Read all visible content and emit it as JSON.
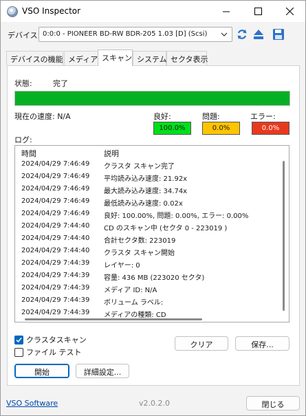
{
  "window": {
    "title": "VSO Inspector"
  },
  "device": {
    "label": "デバイス:",
    "selected": "0:0:0 - PIONEER BD-RW   BDR-205 1.03 [D] (Scsi)"
  },
  "tabs": [
    {
      "label": "デバイスの機能"
    },
    {
      "label": "メディア"
    },
    {
      "label": "スキャン"
    },
    {
      "label": "システム"
    },
    {
      "label": "セクタ表示"
    }
  ],
  "active_tab": "スキャン",
  "scan": {
    "status_label": "状態:",
    "status_value": "完了",
    "progress": 1.0,
    "progress_color": "#06b025",
    "speed_label": "現在の速度: N/A",
    "stats": [
      {
        "label": "良好:",
        "value": "100.0%",
        "color": "#00e01a"
      },
      {
        "label": "問題:",
        "value": "0.0%",
        "color": "#ffc400"
      },
      {
        "label": "エラー:",
        "value": "0.0%",
        "color": "#e8391d"
      }
    ]
  },
  "log": {
    "label": "ログ:",
    "columns": [
      "時間",
      "説明"
    ],
    "rows": [
      {
        "time": "2024/04/29 7:46:49",
        "desc": "クラスタ スキャン完了"
      },
      {
        "time": "2024/04/29 7:46:49",
        "desc": "平均読み込み速度: 21.92x"
      },
      {
        "time": "2024/04/29 7:46:49",
        "desc": "最大読み込み速度: 34.74x"
      },
      {
        "time": "2024/04/29 7:46:49",
        "desc": "最低読み込み速度: 0.02x"
      },
      {
        "time": "2024/04/29 7:46:49",
        "desc": "良好: 100.00%, 問題: 0.00%, エラー: 0.00%"
      },
      {
        "time": "2024/04/29 7:44:40",
        "desc": "CD のスキャン中 (セクタ 0 - 223019 )"
      },
      {
        "time": "2024/04/29 7:44:40",
        "desc": "合計セクタ数: 223019"
      },
      {
        "time": "2024/04/29 7:44:40",
        "desc": "クラスタ スキャン開始"
      },
      {
        "time": "2024/04/29 7:44:39",
        "desc": "レイヤー: 0"
      },
      {
        "time": "2024/04/29 7:44:39",
        "desc": "容量: 436 MB (223020 セクタ)"
      },
      {
        "time": "2024/04/29 7:44:39",
        "desc": "メディア ID: N/A"
      },
      {
        "time": "2024/04/29 7:44:39",
        "desc": "ボリューム ラベル:"
      },
      {
        "time": "2024/04/29 7:44:39",
        "desc": "メディアの種類: CD"
      }
    ]
  },
  "options": {
    "cluster_scan": {
      "label": "クラスタスキャン",
      "checked": true
    },
    "file_test": {
      "label": "ファイル テスト",
      "checked": false
    }
  },
  "buttons": {
    "clear": "クリア",
    "save": "保存...",
    "start": "開始",
    "advanced": "詳細設定...",
    "close": "閉じる"
  },
  "footer": {
    "link": "VSO Software",
    "version": "v2.0.2.0"
  },
  "icons": {
    "app": "disc-icon",
    "refresh": "refresh-icon",
    "eject": "eject-icon",
    "save": "floppy-save-icon"
  },
  "colors": {
    "accent": "#0067c0",
    "link": "#0047ab"
  }
}
